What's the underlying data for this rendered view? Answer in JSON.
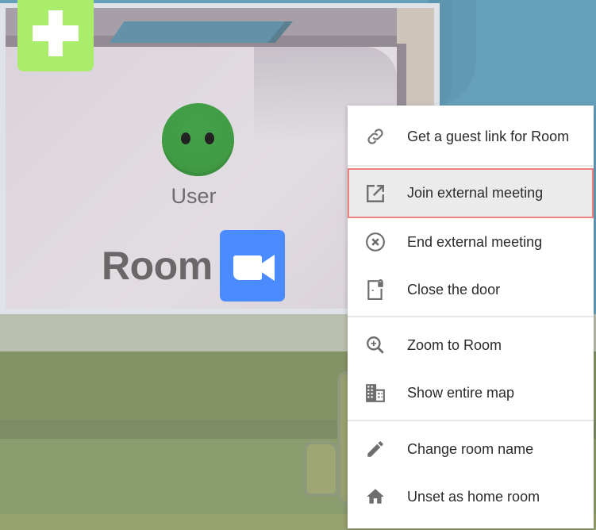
{
  "map": {
    "user_label": "User",
    "room_label": "Room",
    "add_button_icon": "plus-icon",
    "video_button_icon": "video-camera-icon",
    "colors": {
      "water": "#669fb9",
      "add_button": "#a9ed6a",
      "avatar": "#419d45",
      "video_button": "#4a8cff",
      "grass": "#849366"
    }
  },
  "context_menu": {
    "highlight_color": "#f08080",
    "items": [
      {
        "label": "Get a guest link for Room",
        "icon": "link-icon"
      },
      {
        "label": "Join external meeting",
        "icon": "open-in-new-icon",
        "highlighted": true
      },
      {
        "label": "End external meeting",
        "icon": "cancel-circle-icon"
      },
      {
        "label": "Close the door",
        "icon": "door-lock-icon"
      },
      {
        "label": "Zoom to Room",
        "icon": "zoom-in-icon"
      },
      {
        "label": "Show entire map",
        "icon": "building-icon"
      },
      {
        "label": "Change room name",
        "icon": "pencil-icon"
      },
      {
        "label": "Unset as home room",
        "icon": "home-icon"
      }
    ]
  }
}
